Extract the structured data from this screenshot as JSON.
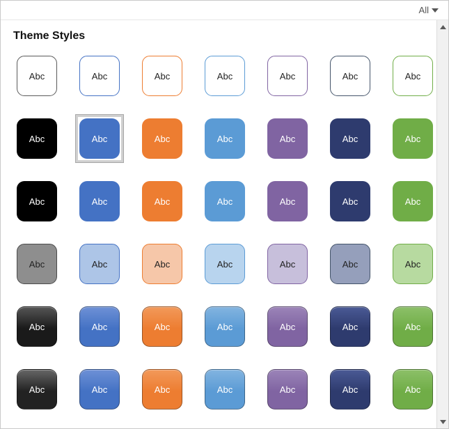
{
  "filter": {
    "label": "All"
  },
  "section_title": "Theme Styles",
  "sample_text": "Abc",
  "colors": {
    "black": "#000000",
    "blue": "#4472C4",
    "orange": "#ED7D31",
    "lightblue": "#5B9BD5",
    "purple": "#8064A2",
    "navy": "#2E3B6E",
    "green": "#70AD47",
    "gray": "#8E8E8E",
    "blue_t": "#ADC5E7",
    "orange_t": "#F6C7A9",
    "lightblue_t": "#B8D4EE",
    "purple_t": "#C7BFDB",
    "navy_t": "#959FBB",
    "green_t": "#B7DAA0",
    "dark1": "#1A1A1A",
    "dark2": "#222222"
  },
  "rows": [
    {
      "type": "outline",
      "items": [
        {
          "border": "#5a5a5a"
        },
        {
          "border": "#4472C4"
        },
        {
          "border": "#ED7D31"
        },
        {
          "border": "#5B9BD5"
        },
        {
          "border": "#8064A2"
        },
        {
          "border": "#44546A"
        },
        {
          "border": "#70AD47"
        }
      ]
    },
    {
      "type": "solid",
      "items": [
        {
          "bg": "#000000",
          "selected": false
        },
        {
          "bg": "#4472C4",
          "selected": true
        },
        {
          "bg": "#ED7D31"
        },
        {
          "bg": "#5B9BD5"
        },
        {
          "bg": "#8064A2"
        },
        {
          "bg": "#2E3B6E"
        },
        {
          "bg": "#70AD47"
        }
      ]
    },
    {
      "type": "solid",
      "items": [
        {
          "bg": "#000000"
        },
        {
          "bg": "#4472C4"
        },
        {
          "bg": "#ED7D31"
        },
        {
          "bg": "#5B9BD5"
        },
        {
          "bg": "#8064A2"
        },
        {
          "bg": "#2E3B6E"
        },
        {
          "bg": "#70AD47"
        }
      ]
    },
    {
      "type": "tinted",
      "items": [
        {
          "bg": "#8E8E8E",
          "border": "#4a4a4a",
          "fg": "#222"
        },
        {
          "bg": "#ADC5E7",
          "border": "#4472C4",
          "fg": "#222"
        },
        {
          "bg": "#F6C7A9",
          "border": "#ED7D31",
          "fg": "#222"
        },
        {
          "bg": "#B8D4EE",
          "border": "#5B9BD5",
          "fg": "#222"
        },
        {
          "bg": "#C7BFDB",
          "border": "#8064A2",
          "fg": "#222"
        },
        {
          "bg": "#959FBB",
          "border": "#44546A",
          "fg": "#222"
        },
        {
          "bg": "#B7DAA0",
          "border": "#70AD47",
          "fg": "#222"
        }
      ]
    },
    {
      "type": "grad",
      "items": [
        {
          "bg": "#1A1A1A",
          "light": "#555"
        },
        {
          "bg": "#4472C4",
          "light": "#6D90D6"
        },
        {
          "bg": "#ED7D31",
          "light": "#F2995A"
        },
        {
          "bg": "#5B9BD5",
          "light": "#82B4E0"
        },
        {
          "bg": "#8064A2",
          "light": "#9B84B8"
        },
        {
          "bg": "#2E3B6E",
          "light": "#4A5A95"
        },
        {
          "bg": "#70AD47",
          "light": "#8CC068"
        }
      ]
    },
    {
      "type": "grad",
      "items": [
        {
          "bg": "#222222",
          "light": "#666"
        },
        {
          "bg": "#4472C4",
          "light": "#6D90D6"
        },
        {
          "bg": "#ED7D31",
          "light": "#F2995A"
        },
        {
          "bg": "#5B9BD5",
          "light": "#82B4E0"
        },
        {
          "bg": "#8064A2",
          "light": "#9B84B8"
        },
        {
          "bg": "#2E3B6E",
          "light": "#4A5A95"
        },
        {
          "bg": "#70AD47",
          "light": "#8CC068"
        }
      ]
    }
  ]
}
